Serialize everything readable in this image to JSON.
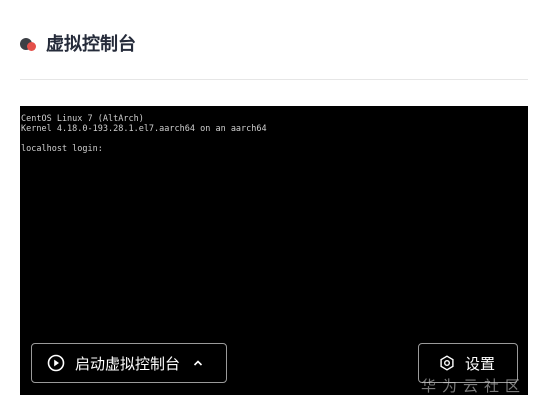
{
  "header": {
    "title": "虚拟控制台"
  },
  "console": {
    "lines": [
      "CentOS Linux 7 (AltArch)",
      "Kernel 4.18.0-193.28.1.el7.aarch64 on an aarch64",
      "",
      "localhost login:"
    ],
    "launch_label": "启动虚拟控制台",
    "settings_label": "设置"
  },
  "watermark": {
    "text": "华为云社区"
  },
  "colors": {
    "accent_red": "#e4504a",
    "dot_dark": "#3c3f45",
    "console_bg": "#000000"
  },
  "icons": {
    "header": "status-dot-icon",
    "launch": "play-circle-icon",
    "chevron": "chevron-up-icon",
    "settings": "hexagon-gear-icon"
  }
}
